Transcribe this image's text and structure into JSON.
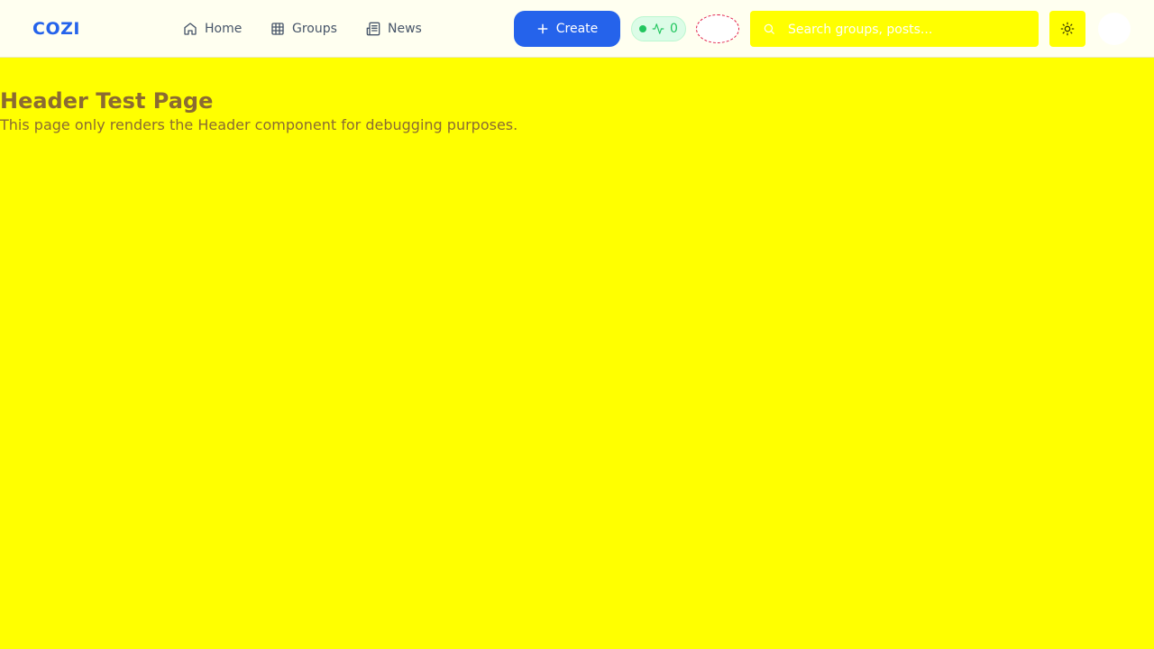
{
  "header": {
    "logo": "COZI",
    "nav": [
      {
        "label": "Home",
        "icon": "home-icon"
      },
      {
        "label": "Groups",
        "icon": "grid-icon"
      },
      {
        "label": "News",
        "icon": "newspaper-icon"
      }
    ],
    "create_label": "Create",
    "activity_count": "0",
    "search_placeholder": "Search groups, posts...",
    "theme_icon": "sun-icon"
  },
  "main": {
    "title": "Header Test Page",
    "description": "This page only renders the Header component for debugging purposes."
  },
  "colors": {
    "accent": "#2563eb",
    "page_background": "#ffff00",
    "header_background": "#fffff0",
    "activity_green": "#22c55e",
    "text_brown": "#8b6b32"
  }
}
